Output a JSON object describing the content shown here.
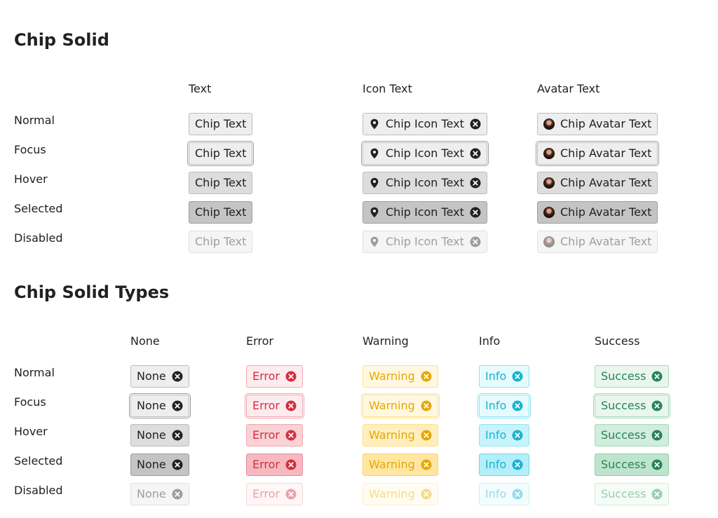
{
  "sections": {
    "solid": {
      "title": "Chip Solid",
      "columns": [
        "Text",
        "Icon Text",
        "Avatar Text"
      ],
      "rows": [
        "Normal",
        "Focus",
        "Hover",
        "Selected",
        "Disabled"
      ],
      "chip_text": "Chip Text",
      "chip_icon_text": "Chip Icon Text",
      "chip_avatar_text": "Chip Avatar Text",
      "icons": {
        "lead": "map-pin-icon",
        "trailing": "close-circle-icon",
        "avatar": "user-avatar"
      }
    },
    "types": {
      "title": "Chip Solid Types",
      "columns": [
        "None",
        "Error",
        "Warning",
        "Info",
        "Success"
      ],
      "rows": [
        "Normal",
        "Focus",
        "Hover",
        "Selected",
        "Disabled"
      ],
      "labels": [
        "None",
        "Error",
        "Warning",
        "Info",
        "Success"
      ],
      "icons": {
        "trailing": "close-circle-icon"
      }
    }
  },
  "colors": {
    "none": "#212121",
    "error": "#d32f3f",
    "warning": "#e6a800",
    "info": "#17b3d2",
    "success": "#258555"
  }
}
